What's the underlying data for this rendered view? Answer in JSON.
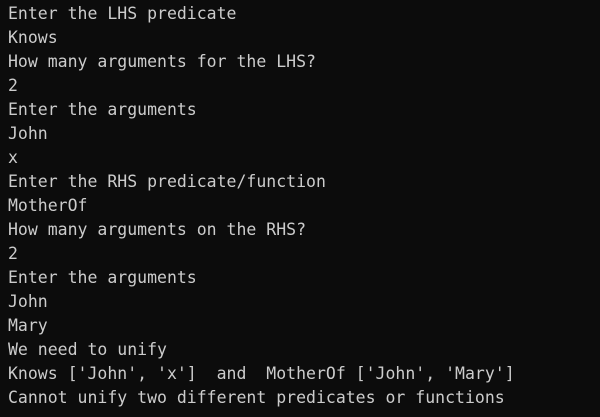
{
  "terminal": {
    "lines": [
      "Enter the LHS predicate",
      "Knows",
      "How many arguments for the LHS?",
      "2",
      "Enter the arguments",
      "John",
      "x",
      "Enter the RHS predicate/function",
      "MotherOf",
      "How many arguments on the RHS?",
      "2",
      "Enter the arguments",
      "John",
      "Mary",
      "We need to unify",
      "Knows ['John', 'x']  and  MotherOf ['John', 'Mary']",
      "Cannot unify two different predicates or functions"
    ]
  }
}
